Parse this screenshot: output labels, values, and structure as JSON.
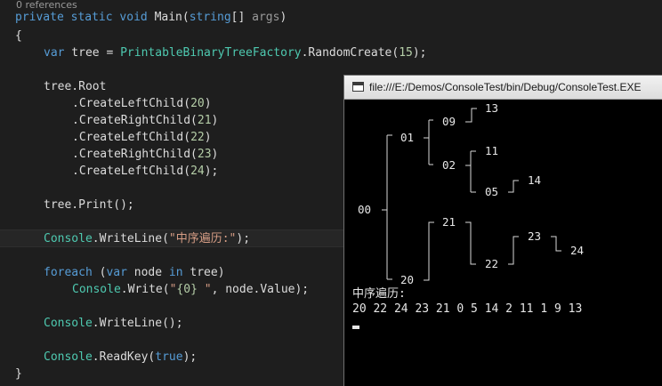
{
  "editor": {
    "references_hint": "0 references",
    "lines": {
      "l1_kw1": "private",
      "l1_kw2": "static",
      "l1_kw3": "void",
      "l1_name": "Main(",
      "l1_type": "string",
      "l1_rest": "[] ",
      "l1_param": "args",
      "l1_close": ")",
      "l2": "{",
      "l3_kw": "var",
      "l3_mid": " tree = ",
      "l3_type": "PrintableBinaryTreeFactory",
      "l3_call": ".RandomCreate(",
      "l3_num": "15",
      "l3_end": ");",
      "l5": "tree.Root",
      "l6_a": ".CreateLeftChild(",
      "l6_n": "20",
      "l6_b": ")",
      "l7_a": ".CreateRightChild(",
      "l7_n": "21",
      "l7_b": ")",
      "l8_a": ".CreateLeftChild(",
      "l8_n": "22",
      "l8_b": ")",
      "l9_a": ".CreateRightChild(",
      "l9_n": "23",
      "l9_b": ")",
      "l10_a": ".CreateLeftChild(",
      "l10_n": "24",
      "l10_b": ");",
      "l12": "tree.Print();",
      "l14_type": "Console",
      "l14_call": ".WriteLine(",
      "l14_str": "\"中序遍历:\"",
      "l14_end": ");",
      "l16_kw1": "foreach",
      "l16_p": " (",
      "l16_kw2": "var",
      "l16_mid": " node ",
      "l16_kw3": "in",
      "l16_end": " tree)",
      "l17_type": "Console",
      "l17_call": ".Write(",
      "l17_str1": "\"",
      "l17_num": "{0}",
      "l17_str2": " \"",
      "l17_end": ", node.Value);",
      "l19_type": "Console",
      "l19_end": ".WriteLine();",
      "l21_type": "Console",
      "l21_call": ".ReadKey(",
      "l21_kw": "true",
      "l21_end": ");",
      "l22": "}"
    }
  },
  "console": {
    "title": "file:///E:/Demos/ConsoleTest/bin/Debug/ConsoleTest.EXE",
    "tree_nodes": {
      "n00": "00",
      "n01": "01",
      "n02": "02",
      "n05": "05",
      "n09": "09",
      "n11": "11",
      "n13": "13",
      "n14": "14",
      "n20": "20",
      "n21": "21",
      "n22": "22",
      "n23": "23",
      "n24": "24"
    },
    "heading": "中序遍历:",
    "traversal": "20 22 24 23 21 0 5 14 2 11 1 9 13"
  },
  "colors": {
    "editor_bg": "#1e1e1e",
    "keyword": "#569cd6",
    "type": "#4ec9b0",
    "string": "#d69d85",
    "number": "#b5cea8",
    "console_bg": "#000000"
  },
  "icons": {
    "console_window": "console-window-icon"
  }
}
